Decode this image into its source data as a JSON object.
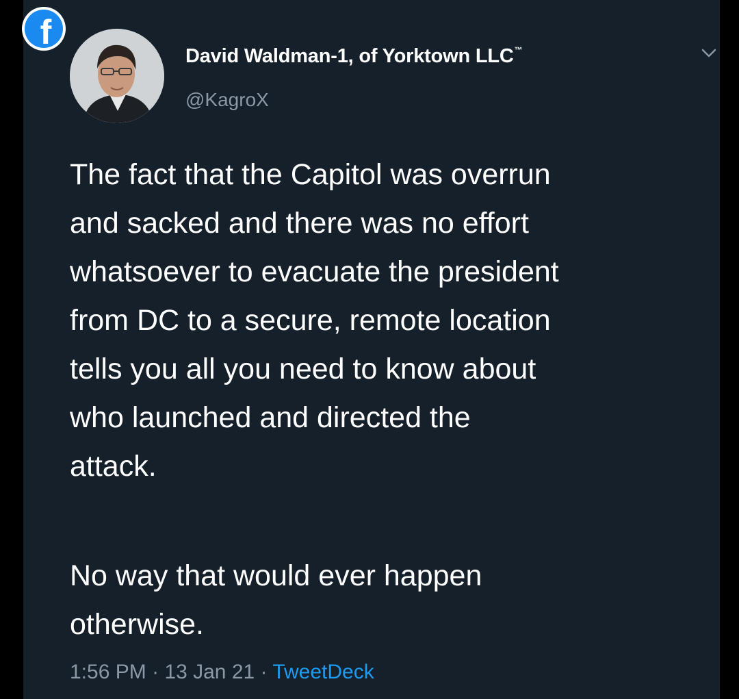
{
  "tweet": {
    "author_name": "David Waldman-1, of Yorktown LLC",
    "author_name_suffix": "™",
    "handle": "@KagroX",
    "paragraph_1": "The fact that the Capitol was overrun\nand sacked and there was no effort\nwhatsoever to evacuate the president\nfrom DC to a secure, remote location\ntells you all you need to know about\nwho launched and directed the\nattack.",
    "paragraph_2": "No way that would ever happen\notherwise.",
    "time": "1:56 PM",
    "date": "13 Jan 21",
    "separator": "·",
    "source": "TweetDeck"
  },
  "icons": {
    "facebook_badge": "facebook-icon",
    "facebook_glyph": "f",
    "menu": "chevron-down-icon"
  },
  "colors": {
    "background": "#15202b",
    "text": "#ffffff",
    "secondary_text": "#8b98a5",
    "link": "#1d9bf0",
    "facebook_blue": "#1b8af0"
  }
}
